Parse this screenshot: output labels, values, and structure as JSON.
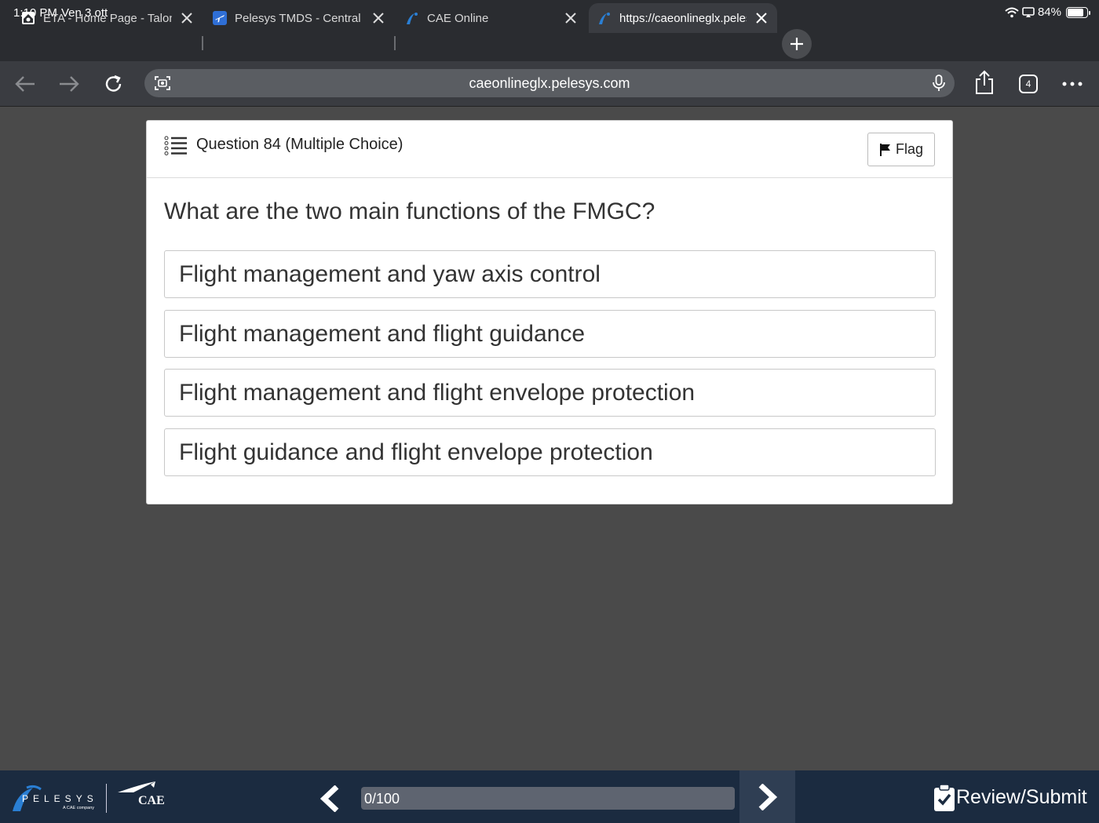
{
  "status_bar": {
    "time": "1:10 PM",
    "date": "Ven 3 ott",
    "battery": "84%"
  },
  "browser": {
    "tabs": [
      {
        "title": "ETA - Home Page - Talon",
        "favicon": "house-icon"
      },
      {
        "title": "Pelesys TMDS - Central",
        "favicon": "airplane-icon"
      },
      {
        "title": "CAE Online",
        "favicon": "pelesys-swoosh-icon"
      },
      {
        "title": "https://caeonlineglx.pelesys.com",
        "favicon": "pelesys-swoosh-icon",
        "active": true
      }
    ],
    "url": "caeonlineglx.pelesys.com",
    "tab_count": "4"
  },
  "question": {
    "header": "Question 84 (Multiple Choice)",
    "flag_label": "Flag",
    "text": "What are the two main functions of the FMGC?",
    "options": [
      "Flight management and yaw axis control",
      "Flight management and flight guidance",
      "Flight management and flight envelope protection",
      "Flight guidance and flight envelope protection"
    ]
  },
  "footer": {
    "brand_pelesys": "PELESYS",
    "brand_pelesys_tagline": "A CAE company",
    "brand_cae": "CAE",
    "progress_text": "0/100",
    "review_label": "Review/Submit"
  },
  "colors": {
    "background": "#4a4a4a",
    "footer": "#1b2b40",
    "browser_chrome": "#2a2c30"
  }
}
